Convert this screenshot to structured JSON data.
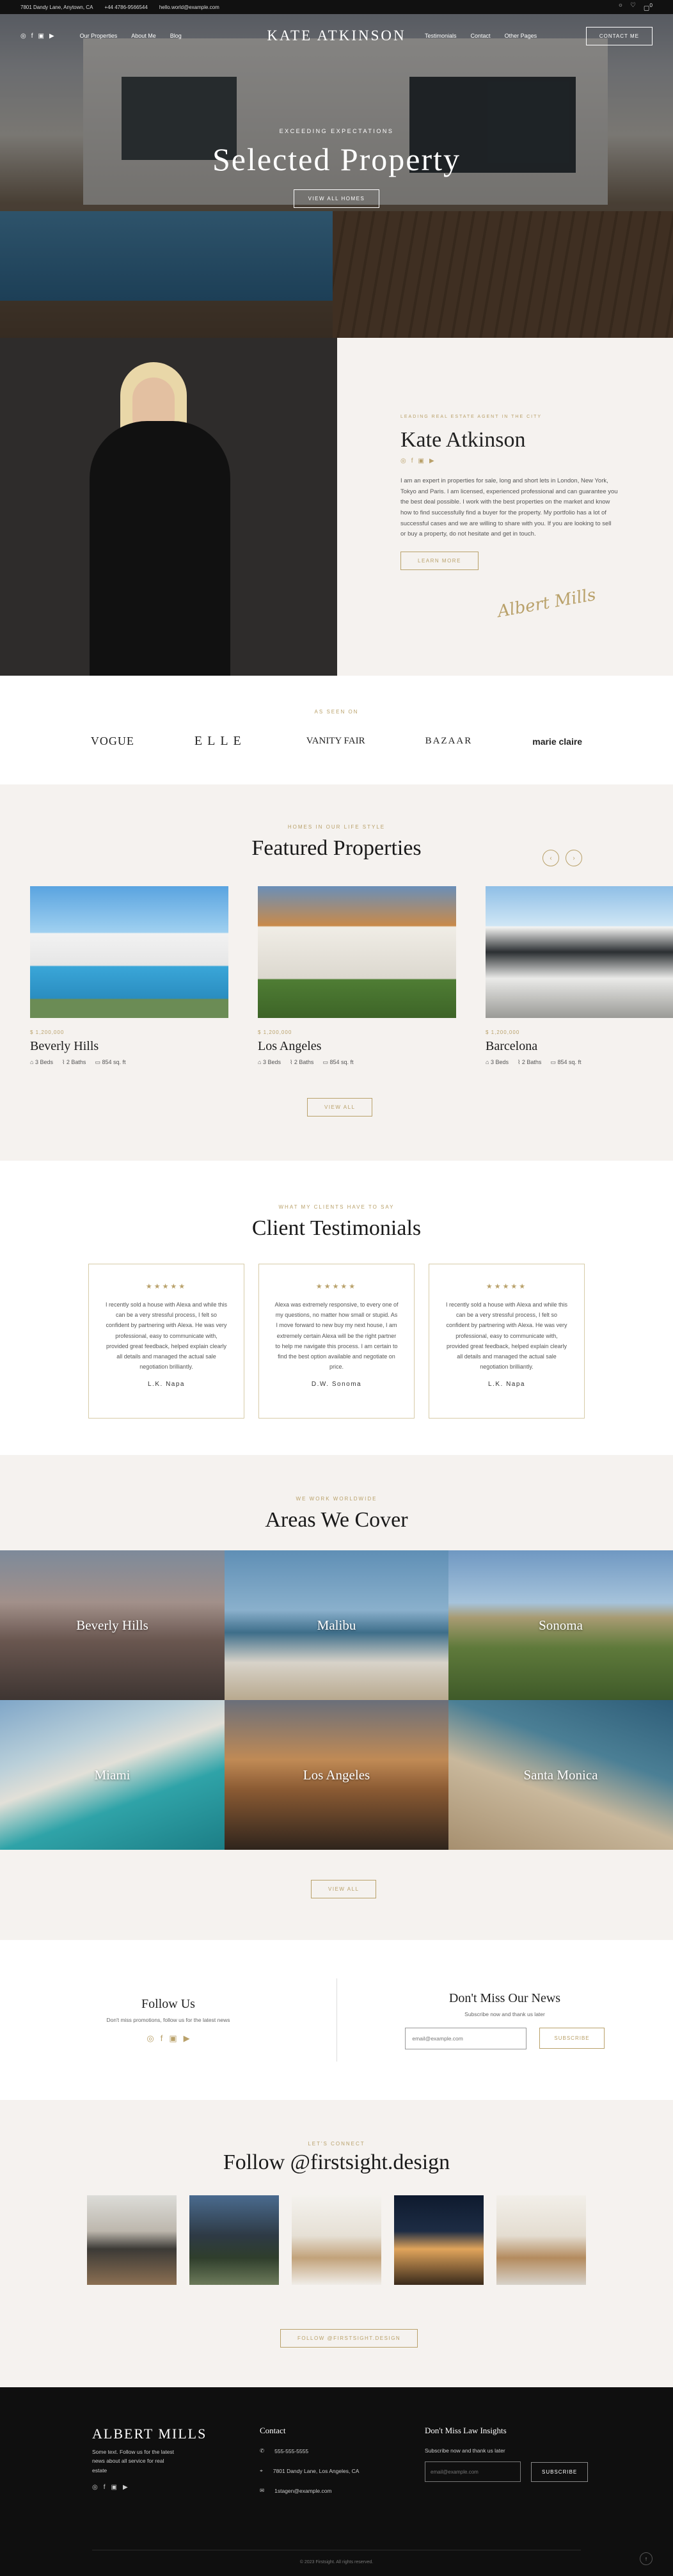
{
  "topbar": {
    "address": "7801 Dandy Lane, Anytown, CA",
    "phone": "+44 4786-9566544",
    "email": "hello.world@example.com",
    "icons": [
      "user-icon",
      "heart-icon",
      "bag-icon"
    ],
    "cart_count": "0"
  },
  "nav": {
    "left_links": [
      "Our Properties",
      "About Me",
      "Blog"
    ],
    "logo": "KATE ATKINSON",
    "right_links": [
      "Testimonials",
      "Contact",
      "Other Pages"
    ],
    "contact_button": "CONTACT ME"
  },
  "hero": {
    "eyebrow": "EXCEEDING EXPECTATIONS",
    "title": "Selected Property",
    "button": "VIEW ALL HOMES"
  },
  "about": {
    "eyebrow": "LEADING REAL ESTATE AGENT IN THE CITY",
    "name": "Kate Atkinson",
    "bio": "I am an expert in properties for sale, long and short lets in London, New York, Tokyo and Paris. I am licensed, experienced professional and can guarantee you the best deal possible. I work with the best properties on the market and know how to find successfully find a buyer for the property. My portfolio has a lot of successful cases and we are willing to share with you. If you are looking to sell or buy a property, do not hesitate and get in touch.",
    "button": "LEARN MORE",
    "signature": "Albert Mills"
  },
  "seen_on": {
    "eyebrow": "AS SEEN ON",
    "logos": [
      "VOGUE",
      "ELLE",
      "VANITY FAIR",
      "BAZAAR",
      "marie claire"
    ]
  },
  "featured": {
    "eyebrow": "HOMES IN OUR LIFE STYLE",
    "title": "Featured Properties",
    "cards": [
      {
        "price": "$ 1,200,000",
        "city": "Beverly Hills",
        "beds": "3 Beds",
        "baths": "2 Baths",
        "area": "854 sq. ft"
      },
      {
        "price": "$ 1,200,000",
        "city": "Los Angeles",
        "beds": "3 Beds",
        "baths": "2 Baths",
        "area": "854 sq. ft"
      },
      {
        "price": "$ 1,200,000",
        "city": "Barcelona",
        "beds": "3 Beds",
        "baths": "2 Baths",
        "area": "854 sq. ft"
      }
    ],
    "button": "VIEW ALL"
  },
  "testimonials": {
    "eyebrow": "WHAT MY CLIENTS HAVE TO SAY",
    "title": "Client Testimonials",
    "items": [
      {
        "stars": "★★★★★",
        "text": "I recently sold a house with Alexa and while this can be a very stressful process, I felt so confident by partnering with Alexa. He was very professional, easy to communicate with, provided great feedback, helped explain clearly all details and managed the actual sale negotiation brilliantly.",
        "name": "L.K. Napa"
      },
      {
        "stars": "★★★★★",
        "text": "Alexa was extremely responsive, to every one of my questions, no matter how small or stupid. As I move forward to new buy my next house, I am extremely certain Alexa will be the right partner to help me navigate this process. I am certain to find the best option available and negotiate on price.",
        "name": "D.W. Sonoma"
      },
      {
        "stars": "★★★★★",
        "text": "I recently sold a house with Alexa and while this can be a very stressful process, I felt so confident by partnering with Alexa. He was very professional, easy to communicate with, provided great feedback, helped explain clearly all details and managed the actual sale negotiation brilliantly.",
        "name": "L.K. Napa"
      }
    ]
  },
  "areas": {
    "eyebrow": "WE WORK WORLDWIDE",
    "title": "Areas We Cover",
    "tiles": [
      "Beverly Hills",
      "Malibu",
      "Sonoma",
      "Miami",
      "Los Angeles",
      "Santa Monica"
    ],
    "button": "VIEW ALL"
  },
  "follow": {
    "title": "Follow Us",
    "sub": "Don't miss promotions, follow us for the latest news",
    "icons": [
      "instagram-icon",
      "facebook-icon",
      "linkedin-icon",
      "youtube-icon"
    ]
  },
  "newsletter": {
    "title": "Don't Miss Our News",
    "sub": "Subscribe now and thank us later",
    "placeholder": "email@example.com",
    "button": "SUBSCRIBE"
  },
  "instagram": {
    "eyebrow": "LET'S CONNECT",
    "title": "Follow @firstsight.design",
    "button": "FOLLOW @FIRSTSIGHT.DESIGN"
  },
  "footer": {
    "brand": "ALBERT MILLS",
    "about": "Some text. Follow us for the latest news about all service for real estate",
    "contact_title": "Contact",
    "phone": "555-555-5555",
    "address": "7801 Dandy Lane, Los Angeles, CA",
    "email": "1stagen@example.com",
    "news_title": "Don't Miss Law Insights",
    "news_sub": "Subscribe now and thank us later",
    "placeholder": "email@example.com",
    "button": "SUBSCRIBE",
    "copyright": "© 2023 Firstsight. All rights reserved.",
    "back_to_top": "↑"
  }
}
